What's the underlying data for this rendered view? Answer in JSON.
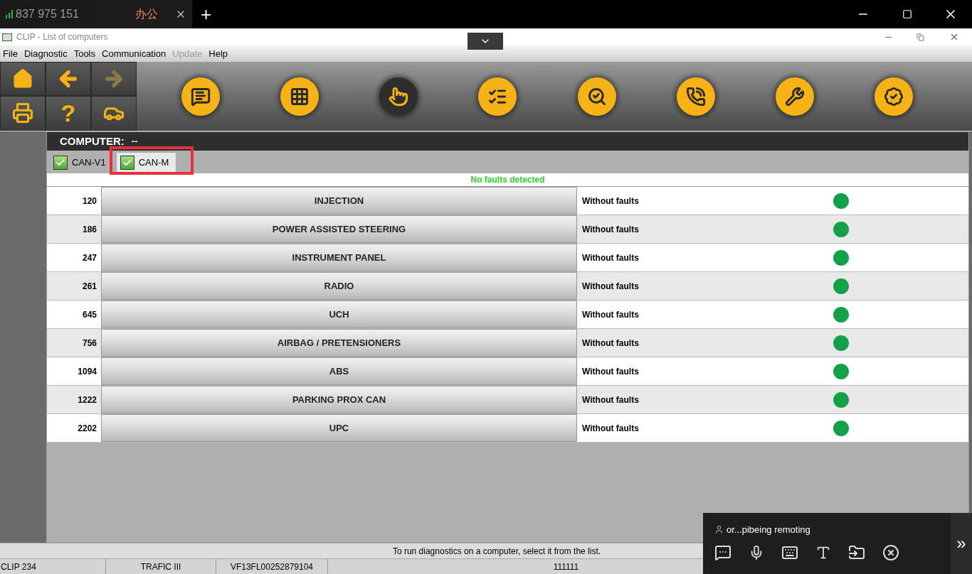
{
  "browser": {
    "tabs": [
      {
        "kind": "signal",
        "label": "837 975 151",
        "selected": false
      },
      {
        "kind": "closable",
        "label": "办公",
        "selected": true
      }
    ],
    "new_tab": "+"
  },
  "window": {
    "title": "CLIP - List of computers"
  },
  "menu": [
    {
      "label": "File",
      "disabled": false
    },
    {
      "label": "Diagnostic",
      "disabled": false
    },
    {
      "label": "Tools",
      "disabled": false
    },
    {
      "label": "Communication",
      "disabled": false
    },
    {
      "label": "Update",
      "disabled": true
    },
    {
      "label": "Help",
      "disabled": false
    }
  ],
  "nav_buttons": [
    {
      "kind": "home",
      "disabled": false
    },
    {
      "kind": "back",
      "disabled": false
    },
    {
      "kind": "forward",
      "disabled": true
    },
    {
      "kind": "print",
      "disabled": false
    },
    {
      "kind": "help",
      "text": "?",
      "disabled": false
    },
    {
      "kind": "vehicle-info",
      "disabled": false
    }
  ],
  "tool_buttons": [
    {
      "kind": "car-message",
      "selected": false
    },
    {
      "kind": "gearbox",
      "selected": false
    },
    {
      "kind": "hand",
      "selected": true
    },
    {
      "kind": "checklist",
      "selected": false
    },
    {
      "kind": "car-search",
      "selected": false
    },
    {
      "kind": "phone",
      "selected": false
    },
    {
      "kind": "wrench",
      "selected": false
    },
    {
      "kind": "car-check",
      "selected": false
    }
  ],
  "panel": {
    "label": "COMPUTER:",
    "value": "--"
  },
  "network_tabs": [
    {
      "label": "CAN-V1",
      "checked": true,
      "selected": false,
      "highlighted": false
    },
    {
      "label": "CAN-M",
      "checked": true,
      "selected": true,
      "highlighted": true
    }
  ],
  "notice": "No faults detected",
  "rows": [
    {
      "code": "120",
      "name": "INJECTION",
      "status": "Without faults"
    },
    {
      "code": "186",
      "name": "POWER ASSISTED STEERING",
      "status": "Without faults"
    },
    {
      "code": "247",
      "name": "INSTRUMENT PANEL",
      "status": "Without faults"
    },
    {
      "code": "261",
      "name": "RADIO",
      "status": "Without faults"
    },
    {
      "code": "645",
      "name": "UCH",
      "status": "Without faults"
    },
    {
      "code": "756",
      "name": "AIRBAG / PRETENSIONERS",
      "status": "Without faults"
    },
    {
      "code": "1094",
      "name": "ABS",
      "status": "Without faults"
    },
    {
      "code": "1222",
      "name": "PARKING PROX CAN",
      "status": "Without faults"
    },
    {
      "code": "2202",
      "name": "UPC",
      "status": "Without faults"
    }
  ],
  "hint": "To run diagnostics on a computer, select it from the list.",
  "status_bar": [
    "CLIP 234",
    "TRAFIC III",
    "VF13FL00252879104",
    "111111"
  ],
  "remote": {
    "user": "or...pibeing remoting",
    "expand": "»"
  }
}
